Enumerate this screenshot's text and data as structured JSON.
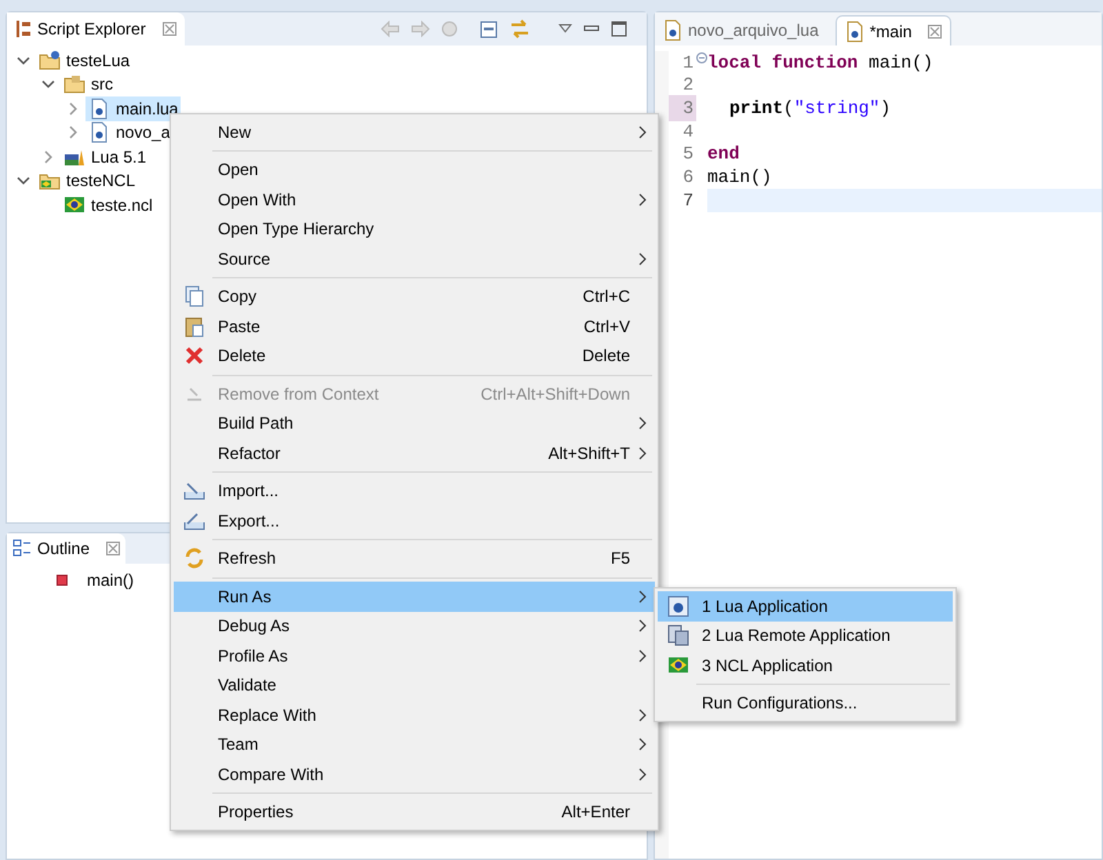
{
  "explorer": {
    "title": "Script Explorer",
    "tree": [
      {
        "label": "testeLua",
        "kind": "project",
        "expanded": true,
        "selected": false,
        "children": [
          {
            "label": "src",
            "kind": "folder",
            "expanded": true,
            "selected": false,
            "children": [
              {
                "label": "main.lua",
                "kind": "file",
                "expanded": false,
                "selected": true
              },
              {
                "label": "novo_a",
                "kind": "file",
                "expanded": false,
                "selected": false
              }
            ]
          },
          {
            "label": "Lua 5.1",
            "kind": "library",
            "expanded": false,
            "selected": false
          }
        ]
      },
      {
        "label": "testeNCL",
        "kind": "ncl-project",
        "expanded": true,
        "selected": false,
        "children": [
          {
            "label": "teste.ncl",
            "kind": "ncl-file",
            "selected": false
          }
        ]
      }
    ]
  },
  "outline": {
    "title": "Outline",
    "items": [
      {
        "label": "main()"
      }
    ]
  },
  "editor": {
    "tabs": [
      {
        "label": "novo_arquivo_lua",
        "selected": false
      },
      {
        "label": "*main",
        "selected": true
      }
    ],
    "lines": [
      {
        "number": "1",
        "marked": false,
        "current": false,
        "tokens": [
          {
            "kind": "keyword",
            "text": "local function"
          },
          {
            "kind": "plain",
            "text": " main()"
          }
        ]
      },
      {
        "number": "2",
        "marked": false,
        "current": false
      },
      {
        "number": "3",
        "marked": true,
        "current": false,
        "indented": true,
        "tokens": [
          {
            "kind": "bold",
            "text": "print"
          },
          {
            "kind": "plain",
            "text": "("
          },
          {
            "kind": "string",
            "text": "\"string\""
          },
          {
            "kind": "plain",
            "text": ")"
          }
        ]
      },
      {
        "number": "4",
        "marked": false,
        "current": false
      },
      {
        "number": "5",
        "marked": false,
        "current": false,
        "tokens": [
          {
            "kind": "keyword",
            "text": "end"
          }
        ]
      },
      {
        "number": "6",
        "marked": false,
        "current": false,
        "tokens": [
          {
            "kind": "plain",
            "text": "main()"
          }
        ]
      },
      {
        "number": "7",
        "marked": false,
        "current": true
      }
    ]
  },
  "context_menu": {
    "items": [
      {
        "kind": "item",
        "label": "New",
        "submenu": true,
        "disabled": false,
        "selected": false
      },
      {
        "kind": "separator"
      },
      {
        "kind": "item",
        "label": "Open",
        "submenu": false,
        "disabled": false,
        "selected": false
      },
      {
        "kind": "item",
        "label": "Open With",
        "submenu": true,
        "disabled": false,
        "selected": false
      },
      {
        "kind": "item",
        "label": "Open Type Hierarchy",
        "submenu": false,
        "disabled": false,
        "selected": false
      },
      {
        "kind": "item",
        "label": "Source",
        "submenu": true,
        "disabled": false,
        "selected": false
      },
      {
        "kind": "separator"
      },
      {
        "kind": "item",
        "label": "Copy",
        "shortcut": "Ctrl+C",
        "submenu": false,
        "disabled": false,
        "selected": false
      },
      {
        "kind": "item",
        "label": "Paste",
        "shortcut": "Ctrl+V",
        "submenu": false,
        "disabled": false,
        "selected": false
      },
      {
        "kind": "item",
        "label": "Delete",
        "shortcut": "Delete",
        "submenu": false,
        "disabled": false,
        "selected": false
      },
      {
        "kind": "separator"
      },
      {
        "kind": "item",
        "label": "Remove from Context",
        "shortcut": "Ctrl+Alt+Shift+Down",
        "submenu": false,
        "disabled": true,
        "selected": false
      },
      {
        "kind": "item",
        "label": "Build Path",
        "submenu": true,
        "disabled": false,
        "selected": false
      },
      {
        "kind": "item",
        "label": "Refactor",
        "shortcut": "Alt+Shift+T",
        "submenu": true,
        "disabled": false,
        "selected": false
      },
      {
        "kind": "separator"
      },
      {
        "kind": "item",
        "label": "Import...",
        "submenu": false,
        "disabled": false,
        "selected": false
      },
      {
        "kind": "item",
        "label": "Export...",
        "submenu": false,
        "disabled": false,
        "selected": false
      },
      {
        "kind": "separator"
      },
      {
        "kind": "item",
        "label": "Refresh",
        "shortcut": "F5",
        "submenu": false,
        "disabled": false,
        "selected": false
      },
      {
        "kind": "separator"
      },
      {
        "kind": "item",
        "label": "Run As",
        "submenu": true,
        "disabled": false,
        "selected": true
      },
      {
        "kind": "item",
        "label": "Debug As",
        "submenu": true,
        "disabled": false,
        "selected": false
      },
      {
        "kind": "item",
        "label": "Profile As",
        "submenu": true,
        "disabled": false,
        "selected": false
      },
      {
        "kind": "item",
        "label": "Validate",
        "submenu": false,
        "disabled": false,
        "selected": false
      },
      {
        "kind": "item",
        "label": "Replace With",
        "submenu": true,
        "disabled": false,
        "selected": false
      },
      {
        "kind": "item",
        "label": "Team",
        "submenu": true,
        "disabled": false,
        "selected": false
      },
      {
        "kind": "item",
        "label": "Compare With",
        "submenu": true,
        "disabled": false,
        "selected": false
      },
      {
        "kind": "separator"
      },
      {
        "kind": "item",
        "label": "Properties",
        "shortcut": "Alt+Enter",
        "submenu": false,
        "disabled": false,
        "selected": false
      }
    ]
  },
  "submenu": {
    "items": [
      {
        "kind": "item",
        "label": "1 Lua Application",
        "selected": true
      },
      {
        "kind": "item",
        "label": "2 Lua Remote Application",
        "selected": false
      },
      {
        "kind": "item",
        "label": "3 NCL Application",
        "selected": false
      },
      {
        "kind": "separator"
      },
      {
        "kind": "item",
        "label": "Run Configurations...",
        "selected": false
      }
    ]
  }
}
